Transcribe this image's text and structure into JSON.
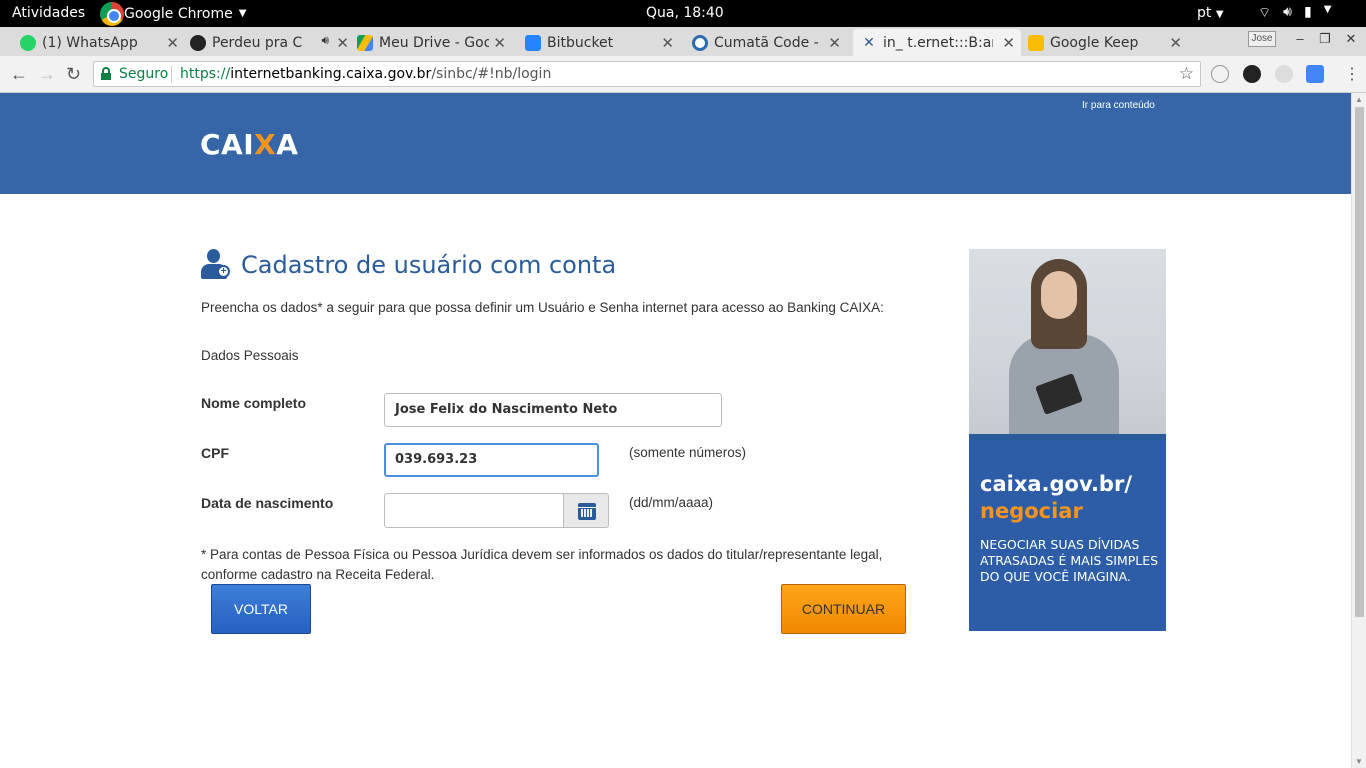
{
  "system": {
    "activities": "Atividades",
    "app_name": "Google Chrome",
    "clock": "Qua, 18:40",
    "language": "pt"
  },
  "tabs": [
    {
      "label": "(1) WhatsApp",
      "icon": "whatsapp-icon",
      "color": "#25d366"
    },
    {
      "label": "Perdeu pra C",
      "icon": "spotify-icon",
      "color": "#1db954"
    },
    {
      "label": "Meu Drive - Goo",
      "icon": "google-drive-icon",
      "color": "#fbbc04"
    },
    {
      "label": "Bitbucket",
      "icon": "bitbucket-icon",
      "color": "#2684ff"
    },
    {
      "label": "Cumatã Code - ",
      "icon": "link-icon",
      "color": "#2b6cb0"
    },
    {
      "label": "in_ t.ernet:::B:an",
      "icon": "caixa-icon",
      "color": "#f7931e"
    },
    {
      "label": "Google Keep",
      "icon": "google-keep-icon",
      "color": "#fbbc04"
    }
  ],
  "window": {
    "user_badge": "Jose"
  },
  "address_bar": {
    "security_label": "Seguro",
    "url_scheme": "https://",
    "url_host": "internetbanking.caixa.gov.br",
    "url_path": "/sinbc/#!nb/login"
  },
  "banner": {
    "skip_link": "Ir para conteúdo",
    "logo_text_a": "CAI",
    "logo_text_x": "X",
    "logo_text_b": "A",
    "background": "#3665a8"
  },
  "form": {
    "title": "Cadastro de usuário com conta",
    "intro": "Preencha os dados* a seguir para que possa definir um Usuário e Senha internet para acesso ao Banking CAIXA:",
    "section": "Dados Pessoais",
    "fields": {
      "name": {
        "label": "Nome completo",
        "value": "Jose Felix do Nascimento Neto"
      },
      "cpf": {
        "label": "CPF",
        "value": "039.693.23",
        "hint": "(somente números)"
      },
      "birth": {
        "label": "Data de nascimento",
        "value": "",
        "hint": "(dd/mm/aaaa)"
      }
    },
    "footnote": "* Para contas de Pessoa Física ou Pessoa Jurídica devem ser informados os dados do titular/representante legal, conforme cadastro na Receita Federal.",
    "back_button": "VOLTAR",
    "continue_button": "CONTINUAR"
  },
  "ad": {
    "title_line1": "caixa.gov.br/",
    "title_line2": "negociar",
    "body": "NEGOCIAR SUAS DÍVIDAS ATRASADAS É MAIS SIMPLES DO QUE VOCÊ IMAGINA."
  },
  "colors": {
    "brand_blue": "#2a5c9b",
    "accent_orange": "#f7931e"
  }
}
